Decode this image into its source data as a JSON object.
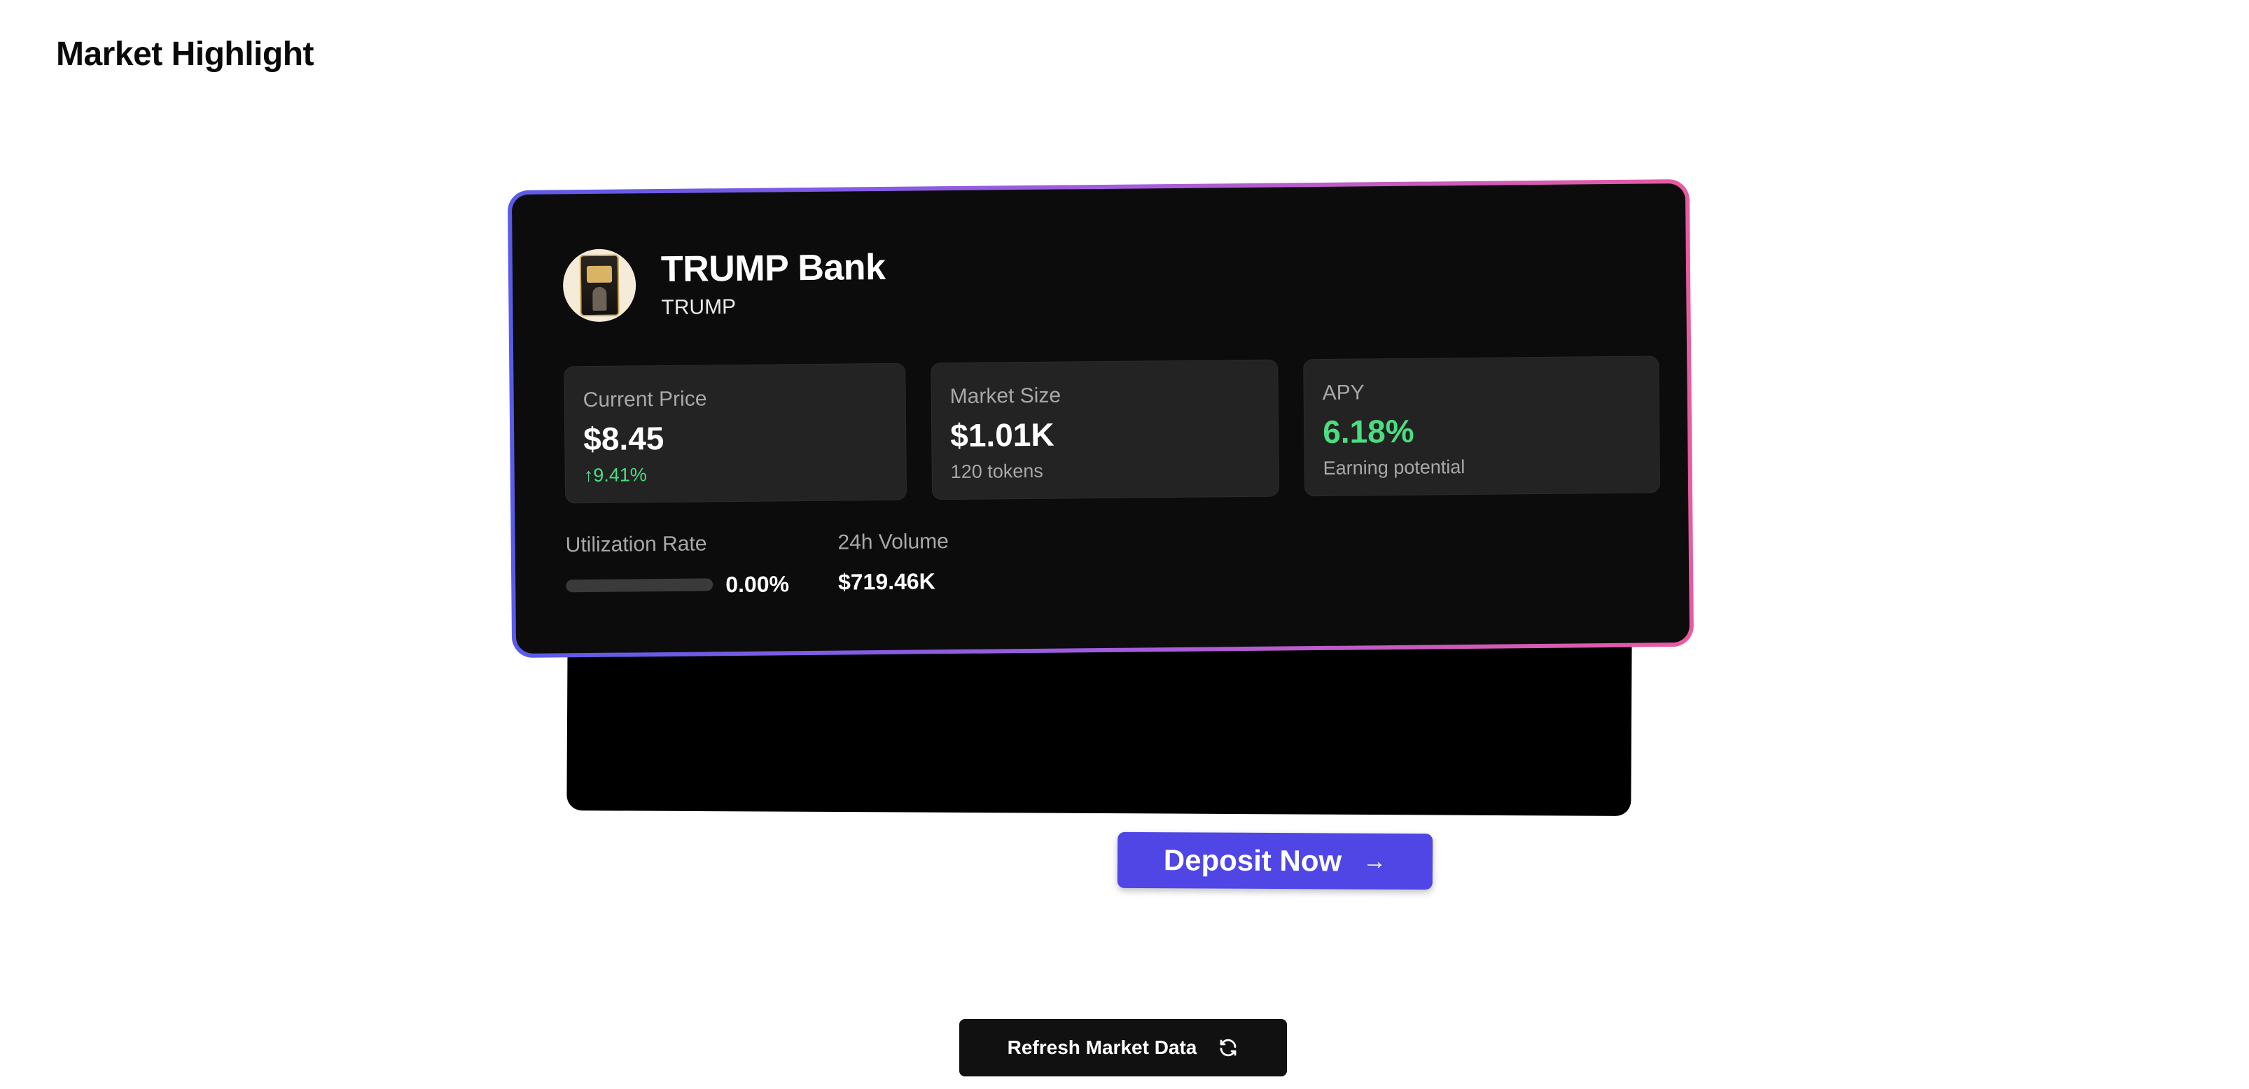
{
  "page": {
    "title": "Market Highlight"
  },
  "market": {
    "name": "TRUMP Bank",
    "symbol": "TRUMP",
    "logo_icon": "trump-token-logo"
  },
  "stats": {
    "price": {
      "label": "Current Price",
      "value": "$8.45",
      "change": "↑9.41%"
    },
    "market_size": {
      "label": "Market Size",
      "value": "$1.01K",
      "sub": "120 tokens"
    },
    "apy": {
      "label": "APY",
      "value": "6.18%",
      "sub": "Earning potential"
    }
  },
  "utilization": {
    "label": "Utilization Rate",
    "value": "0.00%",
    "fraction": 0
  },
  "volume": {
    "label": "24h Volume",
    "value": "$719.46K"
  },
  "actions": {
    "deposit_label": "Deposit Now",
    "refresh_label": "Refresh Market Data"
  },
  "colors": {
    "accent": "#4f46e5",
    "positive": "#4ade80",
    "card_bg": "#0c0c0c",
    "border_gradient": [
      "#5a5be8",
      "#a15ce0",
      "#e85ba2"
    ]
  },
  "icons": {
    "deposit_arrow": "arrow-right-icon",
    "refresh": "refresh-icon"
  }
}
